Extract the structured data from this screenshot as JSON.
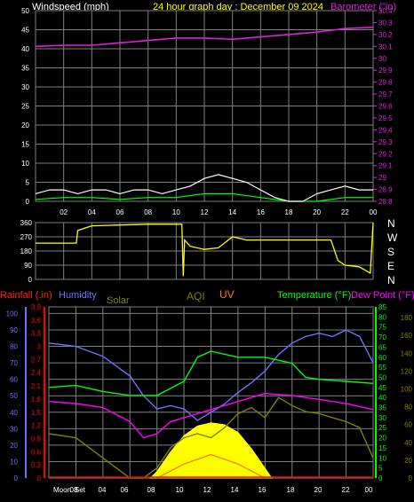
{
  "header": {
    "left_label": "Windspeed (mph)",
    "center_label": "24 hour graph day : December 09 2024",
    "right_label": "Barometer (\"in)"
  },
  "colors": {
    "background": "#000000",
    "plot_bg": "#000000",
    "grid": "#808080",
    "wind": "#ffffff",
    "wind_avg": "#00ff00",
    "barometer": "#e020e0",
    "direction": "#ffff00",
    "rainfall": "#ff0000",
    "humidity": "#7070ff",
    "solar": "#ffff00",
    "aqi": "#808000",
    "uv": "#ff8000",
    "temperature": "#00ff00",
    "dewpoint": "#ff00ff",
    "axis_text": "#ffffff"
  },
  "chart_data": [
    {
      "id": "wind-baro",
      "type": "line",
      "x_ticks": [
        "02",
        "04",
        "06",
        "08",
        "10",
        "12",
        "14",
        "16",
        "18",
        "20",
        "22",
        "00"
      ],
      "y_left_ticks": [
        "0",
        "5",
        "10",
        "15",
        "20",
        "25",
        "30",
        "35",
        "40",
        "45",
        "50"
      ],
      "y_left_range": [
        0,
        50
      ],
      "y_right_ticks": [
        "28.8",
        "28.9",
        "29",
        "29.1",
        "29.2",
        "29.3",
        "29.4",
        "29.5",
        "29.6",
        "29.7",
        "29.8",
        "29.9",
        "30",
        "30.1",
        "30.2",
        "30.3",
        "30.4"
      ],
      "y_right_range": [
        28.8,
        30.4
      ],
      "series": [
        {
          "key": "barometer",
          "x": [
            0,
            2,
            4,
            6,
            8,
            10,
            12,
            14,
            16,
            18,
            20,
            22,
            24
          ],
          "values": [
            30.1,
            30.11,
            30.11,
            30.13,
            30.15,
            30.17,
            30.17,
            30.16,
            30.18,
            30.2,
            30.22,
            30.25,
            30.26
          ]
        },
        {
          "key": "wind_avg",
          "x": [
            0,
            2,
            4,
            6,
            8,
            10,
            12,
            14,
            16,
            18,
            20,
            22,
            24
          ],
          "values": [
            0.5,
            1,
            1,
            0.5,
            1,
            1,
            2,
            2,
            1,
            0,
            0,
            1,
            1
          ]
        },
        {
          "key": "wind_gust",
          "x": [
            0,
            1,
            2,
            3,
            4,
            5,
            6,
            7,
            8,
            9,
            10,
            11,
            12,
            13,
            14,
            15,
            16,
            17,
            18,
            19,
            20,
            21,
            22,
            23,
            24
          ],
          "values": [
            2,
            3,
            3,
            2,
            3,
            3,
            2,
            3,
            3,
            2,
            3,
            4,
            6,
            7,
            6,
            5,
            3,
            1,
            0,
            0,
            2,
            3,
            4,
            3,
            3
          ]
        }
      ]
    },
    {
      "id": "wind-direction",
      "type": "line",
      "y_left_ticks": [
        "360",
        "270",
        "180",
        "90",
        "0"
      ],
      "y_range": [
        0,
        360
      ],
      "compass_labels": [
        "N",
        "W",
        "S",
        "E",
        "N"
      ],
      "series": [
        {
          "key": "direction",
          "x": [
            0,
            2.9,
            3,
            4,
            8,
            10.4,
            10.5,
            10.6,
            11,
            12,
            13,
            14,
            14.5,
            15,
            18,
            21,
            21.5,
            22,
            23,
            23.8,
            24
          ],
          "values": [
            230,
            230,
            310,
            340,
            350,
            350,
            20,
            250,
            210,
            190,
            200,
            270,
            260,
            250,
            250,
            250,
            120,
            90,
            80,
            40,
            360
          ]
        }
      ]
    },
    {
      "id": "weather-multi",
      "type": "line",
      "legend_row": [
        "Rainfall (.in)",
        "Humidity",
        "Solar",
        "AQI",
        "UV",
        "Temperature (°F)",
        "Dew Point (°F)"
      ],
      "x_ticks": [
        "Moon",
        "08",
        "Set",
        "04",
        "06",
        "08",
        "10",
        "12",
        "14",
        "16",
        "18",
        "20",
        "22",
        "00"
      ],
      "y_humidity_ticks": [
        "0",
        "10",
        "20",
        "30",
        "40",
        "50",
        "60",
        "70",
        "80",
        "90",
        "100"
      ],
      "y_rain_ticks": [
        "0",
        "0.3",
        "0.6",
        "0.9",
        "1.2",
        "1.5",
        "1.8",
        "2.1",
        "2.4",
        "2.7",
        "3",
        "3.3",
        "3.6",
        "3.9"
      ],
      "y_temp_ticks": [
        "0",
        "5",
        "10",
        "15",
        "20",
        "25",
        "30",
        "35",
        "40",
        "45",
        "50",
        "55",
        "60",
        "65",
        "70",
        "75",
        "80",
        "85"
      ],
      "y_right2_ticks": [
        "0",
        "20",
        "40",
        "60",
        "80",
        "100",
        "120",
        "140",
        "160",
        "180"
      ],
      "series": [
        {
          "key": "humidity",
          "x": [
            0,
            2,
            4,
            6,
            7,
            8,
            9,
            10,
            11,
            12,
            13,
            14,
            15,
            16,
            17,
            18,
            19,
            20,
            21,
            22,
            23,
            24
          ],
          "values": [
            82,
            80,
            74,
            62,
            50,
            42,
            44,
            42,
            35,
            40,
            45,
            52,
            58,
            65,
            75,
            82,
            86,
            88,
            86,
            90,
            86,
            70
          ]
        },
        {
          "key": "temperature",
          "x": [
            0,
            2,
            4,
            6,
            8,
            10,
            11,
            12,
            14,
            16,
            18,
            19,
            20,
            22,
            24
          ],
          "values": [
            45,
            46,
            43,
            41,
            41,
            48,
            60,
            63,
            60,
            60,
            57,
            50,
            49,
            48,
            47
          ]
        },
        {
          "key": "dewpoint",
          "x": [
            0,
            2,
            4,
            6,
            7,
            8,
            9,
            10,
            12,
            14,
            16,
            18,
            20,
            22,
            24
          ],
          "values": [
            38,
            37,
            35,
            28,
            20,
            22,
            28,
            30,
            34,
            38,
            42,
            41,
            39,
            37,
            34
          ]
        },
        {
          "key": "aqi",
          "x": [
            0,
            2,
            4,
            6,
            7,
            8,
            9,
            10,
            11,
            12,
            13,
            14,
            15,
            16,
            17,
            18,
            19,
            20,
            21,
            22,
            23,
            24
          ],
          "values": [
            22,
            20,
            10,
            0,
            0,
            5,
            15,
            20,
            22,
            20,
            25,
            32,
            35,
            30,
            40,
            36,
            33,
            32,
            30,
            28,
            25,
            10
          ]
        },
        {
          "key": "solar",
          "x": [
            7.5,
            8,
            9,
            10,
            11,
            12,
            13,
            14,
            15,
            16,
            16.5
          ],
          "values": [
            0,
            10,
            40,
            65,
            80,
            85,
            82,
            70,
            45,
            15,
            0
          ]
        },
        {
          "key": "uv",
          "x": [
            8,
            10,
            12,
            14,
            16
          ],
          "values": [
            0,
            1.5,
            2.5,
            1.5,
            0
          ]
        }
      ]
    }
  ]
}
